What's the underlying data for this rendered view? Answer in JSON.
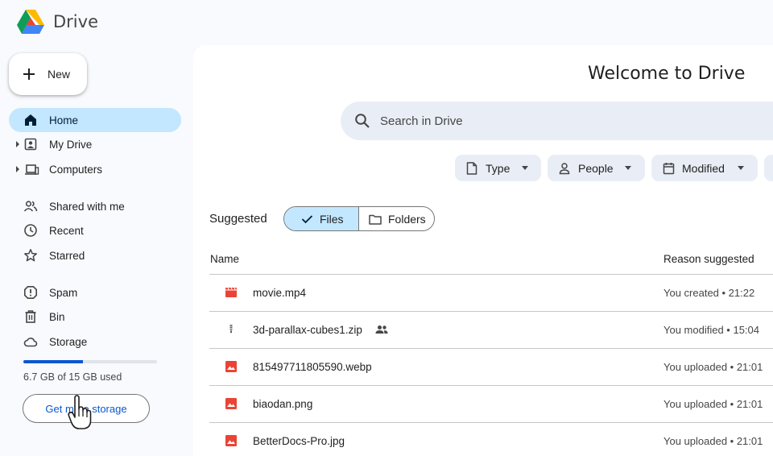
{
  "app": {
    "name": "Drive"
  },
  "new_button": {
    "label": "New"
  },
  "nav": {
    "primary": [
      {
        "label": "Home",
        "icon": "home-icon",
        "active": true
      },
      {
        "label": "My Drive",
        "icon": "my-drive-icon",
        "expandable": true
      },
      {
        "label": "Computers",
        "icon": "computers-icon",
        "expandable": true
      }
    ],
    "secondary": [
      {
        "label": "Shared with me",
        "icon": "people-icon"
      },
      {
        "label": "Recent",
        "icon": "clock-icon"
      },
      {
        "label": "Starred",
        "icon": "star-icon"
      }
    ],
    "tertiary": [
      {
        "label": "Spam",
        "icon": "spam-icon"
      },
      {
        "label": "Bin",
        "icon": "bin-icon"
      },
      {
        "label": "Storage",
        "icon": "cloud-icon"
      }
    ]
  },
  "storage": {
    "used_text": "6.7 GB of 15 GB used",
    "used_fraction": 0.447,
    "button_label": "Get more storage"
  },
  "main": {
    "title": "Welcome to Drive",
    "search_placeholder": "Search in Drive",
    "filters": [
      {
        "label": "Type",
        "icon": "file-icon"
      },
      {
        "label": "People",
        "icon": "person-icon"
      },
      {
        "label": "Modified",
        "icon": "calendar-icon"
      }
    ],
    "suggested_label": "Suggested",
    "toggle": {
      "files": "Files",
      "folders": "Folders",
      "selected": "files"
    },
    "columns": {
      "name": "Name",
      "reason": "Reason suggested"
    },
    "rows": [
      {
        "name": "movie.mp4",
        "icon": "video-icon",
        "reason": "You created • 21:22",
        "shared": false
      },
      {
        "name": "3d-parallax-cubes1.zip",
        "icon": "zip-icon",
        "reason": "You modified • 15:04",
        "shared": true
      },
      {
        "name": "815497711805590.webp",
        "icon": "image-icon",
        "reason": "You uploaded • 21:01",
        "shared": false
      },
      {
        "name": "biaodan.png",
        "icon": "image-icon",
        "reason": "You uploaded • 21:01",
        "shared": false
      },
      {
        "name": "BetterDocs-Pro.jpg",
        "icon": "image-icon",
        "reason": "You uploaded • 21:01",
        "shared": false
      }
    ]
  },
  "colors": {
    "accent": "#0b57d0",
    "active_bg": "#c2e7ff",
    "file_red": "#ea4335"
  }
}
